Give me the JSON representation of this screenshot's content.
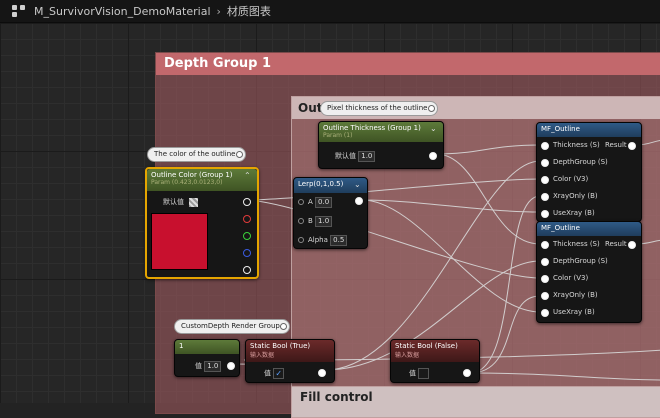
{
  "breadcrumb": {
    "material": "M_SurvivorVision_DemoMaterial",
    "graph": "材质图表"
  },
  "comments": {
    "depth_group": "Depth Group 1",
    "outline": "Outline",
    "fill": "Fill control"
  },
  "bubbles": {
    "outline_color": "The color of the outline",
    "thickness": "Pixel thickness of the outline",
    "custom_depth": "CustomDepth Render Group"
  },
  "outline_color": {
    "title": "Outline Color (Group 1)",
    "subtitle": "Param (0.423,0.0123,0)",
    "default_label": "默认值",
    "swatch": "#c8102e"
  },
  "thickness": {
    "title": "Outline Thickness (Group 1)",
    "subtitle": "Param (1)",
    "default_label": "默认值",
    "value": "1.0"
  },
  "lerp": {
    "title": "Lerp(0,1,0.5)",
    "a_label": "A",
    "a_value": "0.0",
    "b_label": "B",
    "b_value": "1.0",
    "alpha_label": "Alpha",
    "alpha_value": "0.5"
  },
  "mf_outline_1": {
    "title": "MF_Outline",
    "inputs": [
      "Thickness (S)",
      "DepthGroup (S)",
      "Color (V3)",
      "XrayOnly (B)",
      "UseXray (B)"
    ],
    "output": "Result"
  },
  "mf_outline_2": {
    "title": "MF_Outline",
    "inputs": [
      "Thickness (S)",
      "DepthGroup (S)",
      "Color (V3)",
      "XrayOnly (B)",
      "UseXray (B)"
    ],
    "output": "Result"
  },
  "const_node": {
    "title": "1",
    "label": "值",
    "value": "1.0"
  },
  "static_true": {
    "title": "Static Bool (True)",
    "subtitle": "输入数据",
    "label": "值"
  },
  "static_false": {
    "title": "Static Bool (False)",
    "subtitle": "输入数据",
    "label": "值"
  }
}
